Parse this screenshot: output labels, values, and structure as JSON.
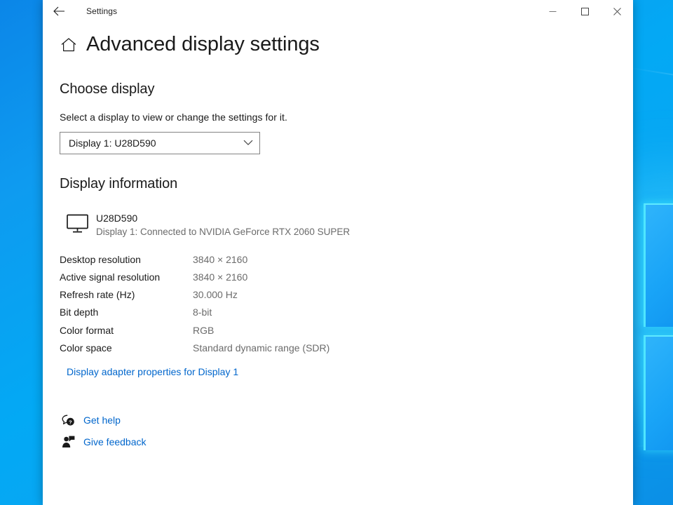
{
  "window": {
    "titlebar_title": "Settings",
    "back_icon": "back-arrow-icon",
    "minimize_label": "–",
    "maximize_label": "□",
    "close_label": "✕"
  },
  "page": {
    "home_icon": "home-icon",
    "title": "Advanced display settings"
  },
  "choose_display": {
    "heading": "Choose display",
    "description": "Select a display to view or change the settings for it.",
    "dropdown": {
      "selected": "Display 1: U28D590",
      "chevron_icon": "chevron-down-icon"
    }
  },
  "display_information": {
    "heading": "Display information",
    "monitor_icon": "monitor-icon",
    "monitor_name": "U28D590",
    "monitor_connection": "Display 1: Connected to NVIDIA GeForce RTX 2060 SUPER",
    "rows": [
      {
        "label": "Desktop resolution",
        "value": "3840 × 2160"
      },
      {
        "label": "Active signal resolution",
        "value": "3840 × 2160"
      },
      {
        "label": "Refresh rate (Hz)",
        "value": "30.000 Hz"
      },
      {
        "label": "Bit depth",
        "value": "8-bit"
      },
      {
        "label": "Color format",
        "value": "RGB"
      },
      {
        "label": "Color space",
        "value": "Standard dynamic range (SDR)"
      }
    ],
    "adapter_link": "Display adapter properties for Display 1"
  },
  "footer": {
    "links": [
      {
        "label": "Get help",
        "icon": "help-bubble-icon"
      },
      {
        "label": "Give feedback",
        "icon": "feedback-person-icon"
      }
    ]
  },
  "colors": {
    "link": "#0066cc",
    "text_primary": "#1a1a1a",
    "text_secondary": "#6b6b6b",
    "desktop_blue": "#03a9f4",
    "pane_glow": "#4fe6ff"
  }
}
